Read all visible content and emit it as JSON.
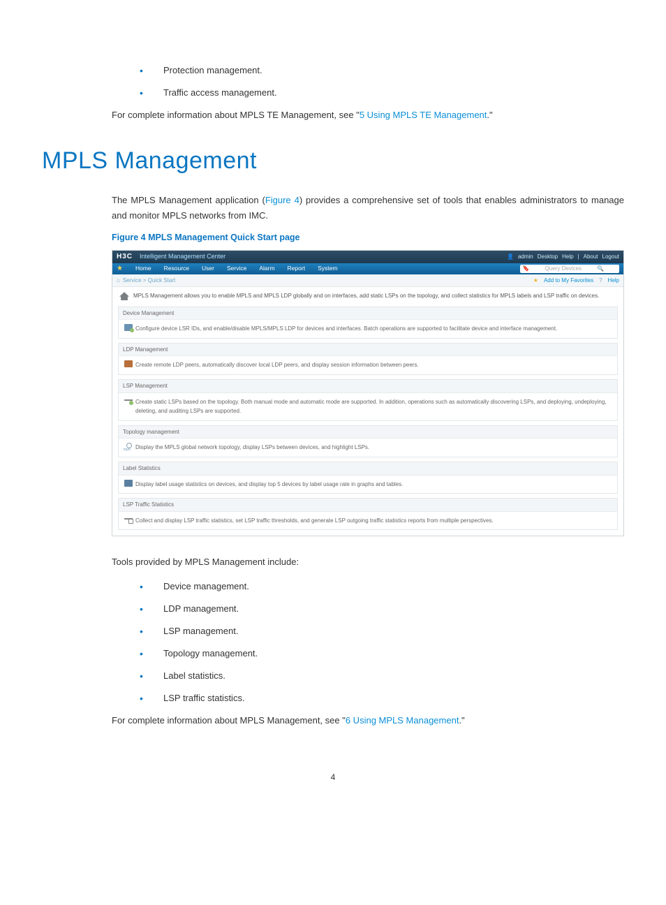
{
  "intro_bullets": [
    "Protection management.",
    "Traffic access management."
  ],
  "intro_para_prefix": "For complete information about MPLS TE Management, see \"",
  "intro_para_link": "5 Using MPLS TE Management",
  "intro_para_suffix": ".\"",
  "h1": "MPLS Management",
  "main_para_1a": "The MPLS Management application (",
  "main_para_1_link": "Figure 4",
  "main_para_1b": ") provides a comprehensive set of tools that enables administrators to manage and monitor MPLS networks from IMC.",
  "fig_caption": "Figure 4 MPLS Management Quick Start page",
  "figure": {
    "logo": "H3C",
    "title": "Intelligent Management Center",
    "top_right": [
      "admin",
      "Desktop",
      "Help",
      "|",
      "About",
      "Logout"
    ],
    "nav": [
      "Home",
      "Resource",
      "User",
      "Service",
      "Alarm",
      "Report",
      "System"
    ],
    "search_placeholder": "Query Devices",
    "breadcrumb": "Service > Quick Start",
    "fav_link": "Add to My Favorites",
    "help_link": "Help",
    "intro": "MPLS Management allows you to enable MPLS and MPLS LDP globally and on interfaces, add static LSPs on the topology, and collect statistics for MPLS labels and LSP traffic on devices.",
    "sections": [
      {
        "title": "Device Management",
        "body": "Configure device LSR IDs, and enable/disable MPLS/MPLS LDP for devices and interfaces. Batch operations are supported to facilitate device and interface management."
      },
      {
        "title": "LDP Management",
        "body": "Create remote LDP peers, automatically discover local LDP peers, and display session information between peers."
      },
      {
        "title": "LSP Management",
        "body": "Create static LSPs based on the topology. Both manual mode and automatic mode are supported. In addition, operations such as automatically discovering LSPs, and deploying, undeploying, deleting, and auditing LSPs are supported."
      },
      {
        "title": "Topology management",
        "body": "Display the MPLS global network topology, display LSPs between devices, and highlight LSPs."
      },
      {
        "title": "Label Statistics",
        "body": "Display label usage statistics on devices, and display top 5 devices by label usage rate in graphs and tables."
      },
      {
        "title": "LSP Traffic Statistics",
        "body": "Collect and display LSP traffic statistics, set LSP traffic thresholds, and generate LSP outgoing traffic statistics reports from multiple perspectives."
      }
    ]
  },
  "tools_heading": "Tools provided by MPLS Management include:",
  "tools_bullets": [
    "Device management.",
    "LDP management.",
    "LSP management.",
    "Topology management.",
    "Label statistics.",
    "LSP traffic statistics."
  ],
  "closing_prefix": "For complete information about MPLS Management, see \"",
  "closing_link": "6 Using MPLS Management",
  "closing_suffix": ".\"",
  "page_number": "4"
}
